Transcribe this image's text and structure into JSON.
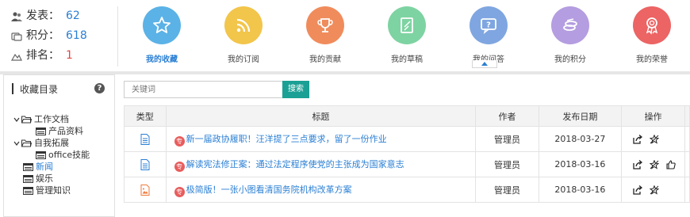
{
  "stats": [
    {
      "label": "发表：",
      "value": "62",
      "icon": "people-icon",
      "color": "#2a7fd4"
    },
    {
      "label": "积分：",
      "value": "618",
      "icon": "coins-icon",
      "color": "#2a7fd4"
    },
    {
      "label": "排名：",
      "value": "1",
      "icon": "mountain-icon",
      "color": "#e04848"
    }
  ],
  "nav": [
    {
      "label": "我的收藏",
      "color": "#5bb2e6",
      "icon": "star-icon",
      "active": true
    },
    {
      "label": "我的订阅",
      "color": "#f2c54b",
      "icon": "rss-icon"
    },
    {
      "label": "我的贡献",
      "color": "#f08c5c",
      "icon": "trophy-icon"
    },
    {
      "label": "我的草稿",
      "color": "#7ed3a2",
      "icon": "draft-icon"
    },
    {
      "label": "我的问答",
      "color": "#7fa6e0",
      "icon": "question-icon"
    },
    {
      "label": "我的积分",
      "color": "#b49de0",
      "icon": "coins-icon"
    },
    {
      "label": "我的荣誉",
      "color": "#ec6464",
      "icon": "medal-icon"
    }
  ],
  "sidebar": {
    "title": "收藏目录",
    "help": "?",
    "tree": [
      {
        "label": "工作文档",
        "level": 1,
        "folder": true
      },
      {
        "label": "产品资料",
        "level": 2
      },
      {
        "label": "自我拓展",
        "level": 1,
        "folder": true
      },
      {
        "label": "office技能",
        "level": 2
      },
      {
        "label": "新闻",
        "level": 1,
        "selected": true
      },
      {
        "label": "娱乐",
        "level": 1
      },
      {
        "label": "管理知识",
        "level": 1
      }
    ]
  },
  "search": {
    "placeholder": "关键词",
    "button": "搜索"
  },
  "table": {
    "headers": [
      "类型",
      "标题",
      "作者",
      "发布日期",
      "操作"
    ],
    "rows": [
      {
        "type": "doc",
        "badge": "专",
        "title": "新一届政协履职！汪洋提了三点要求，留了一份作业",
        "author": "管理员",
        "date": "2018-03-27",
        "ops": [
          "share-icon",
          "unfavorite-icon"
        ]
      },
      {
        "type": "doc",
        "badge": "专",
        "title": "解读宪法修正案：通过法定程序使党的主张成为国家意志",
        "author": "管理员",
        "date": "2018-03-16",
        "ops": [
          "share-icon",
          "unfavorite-icon",
          "like-icon"
        ]
      },
      {
        "type": "image",
        "badge": "专",
        "title": "极简版！一张小图看清国务院机构改革方案",
        "author": "管理员",
        "date": "2018-03-16",
        "ops": [
          "share-icon",
          "unfavorite-icon"
        ]
      }
    ]
  }
}
